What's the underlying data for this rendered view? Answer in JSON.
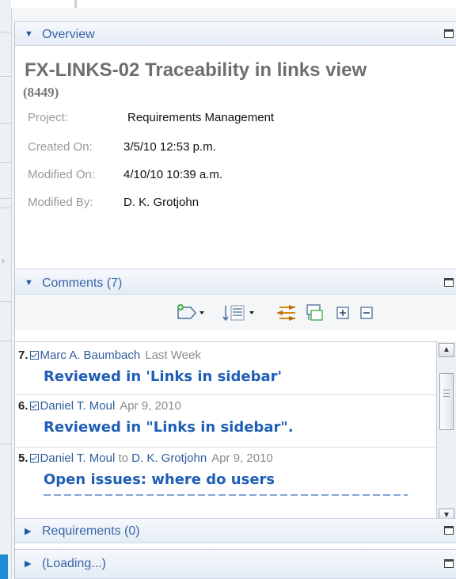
{
  "overview": {
    "section_label": "Overview",
    "title": "FX-LINKS-02 Traceability in links view",
    "id": "(8449)",
    "properties": [
      {
        "label": "Project:",
        "value": "Requirements Management"
      },
      {
        "label": "Created On:",
        "value": "3/5/10 12:53 p.m."
      },
      {
        "label": "Modified On:",
        "value": "4/10/10 10:39 a.m."
      },
      {
        "label": "Modified By:",
        "value": "D. K. Grotjohn"
      }
    ]
  },
  "comments": {
    "section_label": "Comments (7)",
    "toolbar_icons": [
      "add-comment-icon",
      "sort-icon",
      "filter-icon",
      "reply-icon",
      "expand-all-icon",
      "collapse-all-icon"
    ],
    "items": [
      {
        "number": "7.",
        "author": "Marc A. Baumbach",
        "recipient_prefix": "",
        "recipient": "",
        "date": "Last Week",
        "text": "Reviewed in 'Links in sidebar'"
      },
      {
        "number": "6.",
        "author": "Daniel T. Moul",
        "recipient_prefix": "",
        "recipient": "",
        "date": "Apr 9, 2010",
        "text": "Reviewed in \"Links in sidebar\"."
      },
      {
        "number": "5.",
        "author": "Daniel T. Moul",
        "recipient_prefix": "to",
        "recipient": "D. K. Grotjohn",
        "date": "Apr 9, 2010",
        "text": "Open issues: where do users"
      }
    ]
  },
  "requirements": {
    "section_label": "Requirements (0)"
  },
  "loading": {
    "section_label": "(Loading...)"
  },
  "colors": {
    "link_blue": "#1f5eb6",
    "header_blue": "#3a64a8",
    "accent": "#1c8fd6"
  }
}
